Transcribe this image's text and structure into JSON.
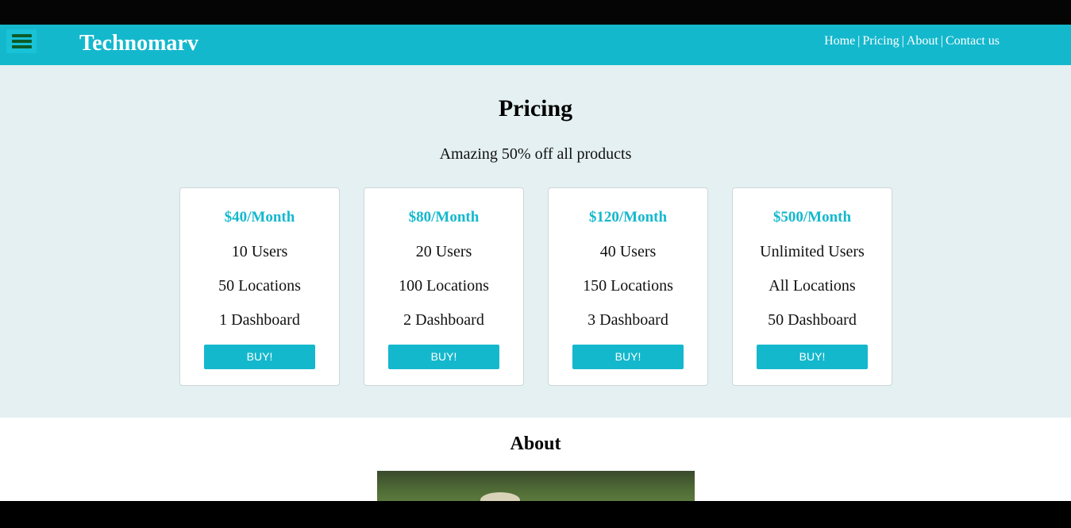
{
  "header": {
    "brand": "Technomarv",
    "menu_icon": "hamburger-menu-icon",
    "nav": [
      "Home",
      "Pricing",
      "About",
      "Contact us"
    ],
    "separator": "|"
  },
  "pricing": {
    "title": "Pricing",
    "subtitle": "Amazing 50% off all products",
    "plans": [
      {
        "price": "$40/Month",
        "users": "10 Users",
        "locations": "50 Locations",
        "dashboards": "1 Dashboard",
        "button": "BUY!"
      },
      {
        "price": "$80/Month",
        "users": "20 Users",
        "locations": "100 Locations",
        "dashboards": "2 Dashboard",
        "button": "BUY!"
      },
      {
        "price": "$120/Month",
        "users": "40 Users",
        "locations": "150 Locations",
        "dashboards": "3 Dashboard",
        "button": "BUY!"
      },
      {
        "price": "$500/Month",
        "users": "Unlimited Users",
        "locations": "All Locations",
        "dashboards": "50 Dashboard",
        "button": "BUY!"
      }
    ]
  },
  "about": {
    "title": "About"
  },
  "colors": {
    "accent": "#14b8cd",
    "pricing_bg": "#e4f0f1",
    "menu_bars": "#0b5c2a"
  }
}
